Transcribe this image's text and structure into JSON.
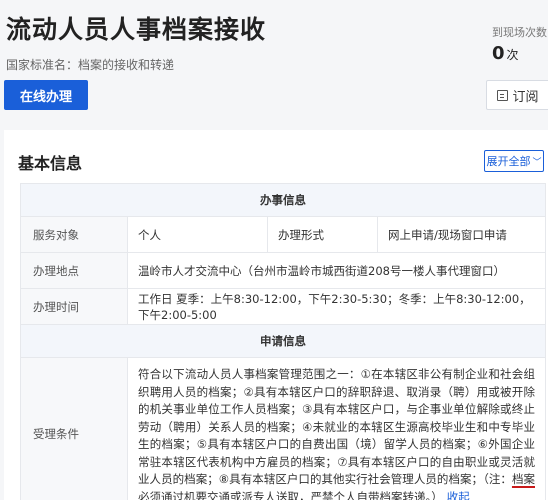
{
  "header": {
    "title": "流动人员人事档案接收",
    "standard_name": "国家标准名：档案的接收和转递",
    "visits_label": "到现场次数",
    "visits_count": "0",
    "visits_unit": "次",
    "online_button": "在线办理",
    "subscribe_button": "订阅"
  },
  "basic_info": {
    "title": "基本信息",
    "expand_button": "展开全部",
    "group1_title": "办事信息",
    "service_target_label": "服务对象",
    "service_target_value": "个人",
    "method_label": "办理形式",
    "method_value": "网上申请/现场窗口申请",
    "location_label": "办理地点",
    "location_value": "温岭市人才交流中心（台州市温岭市城西街道208号一楼人事代理窗口）",
    "time_label": "办理时间",
    "time_value": "工作日 夏季：上午8:30-12:00，下午2:30-5:30；冬季：上午8:30-12:00，下午2:00-5:00",
    "group2_title": "申请信息",
    "conditions_label": "受理条件",
    "conditions_text": "符合以下流动人员人事档案管理范围之一：①在本辖区非公有制企业和社会组织聘用人员的档案；②具有本辖区户口的辞职辞退、取消录（聘）用或被开除的机关事业单位工作人员档案；③具有本辖区户口，与企事业单位解除或终止劳动（聘用）关系人员的档案；④未就业的本辖区生源高校毕业生和中专毕业生的档案；⑤具有本辖区户口的自费出国（境）留学人员的档案；⑥外国企业常驻本辖区代表机构中方雇员的档案；⑦具有本辖区户口的自由职业或灵活就业人员的档案；⑧具有本辖区户口的其他实行社会管理人员的档案；（注：",
    "conditions_highlight": "档案必须通过机要交通或派专人送取，严禁个人自带档案转递。",
    "conditions_close": "）",
    "collapse_link": "收起"
  }
}
